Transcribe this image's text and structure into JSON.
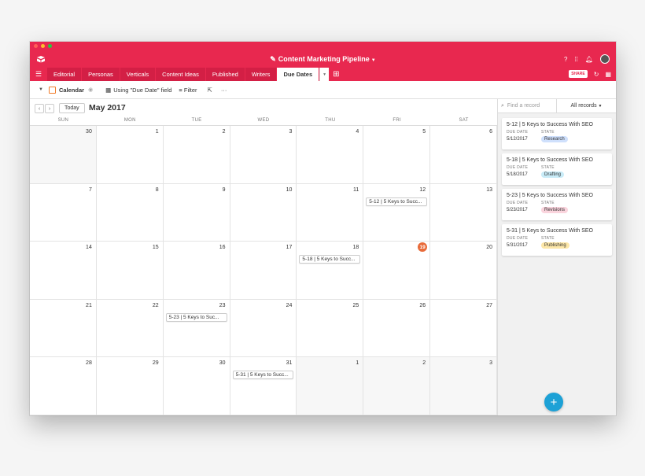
{
  "base": {
    "title": "Content Marketing Pipeline"
  },
  "tabs": [
    {
      "label": "Editorial"
    },
    {
      "label": "Personas"
    },
    {
      "label": "Verticals"
    },
    {
      "label": "Content Ideas"
    },
    {
      "label": "Published"
    },
    {
      "label": "Writers"
    },
    {
      "label": "Due Dates",
      "active": true
    }
  ],
  "share_label": "SHARE",
  "view": {
    "name": "Calendar",
    "using_label": "Using \"Due Date\" field",
    "filter_label": "Filter"
  },
  "calendar": {
    "today_label": "Today",
    "month_label": "May 2017",
    "weekdays": [
      "SUN",
      "MON",
      "TUE",
      "WED",
      "THU",
      "FRI",
      "SAT"
    ],
    "days": [
      {
        "n": "30",
        "other": true
      },
      {
        "n": "1"
      },
      {
        "n": "2"
      },
      {
        "n": "3"
      },
      {
        "n": "4"
      },
      {
        "n": "5"
      },
      {
        "n": "6"
      },
      {
        "n": "7"
      },
      {
        "n": "8"
      },
      {
        "n": "9"
      },
      {
        "n": "10"
      },
      {
        "n": "11"
      },
      {
        "n": "12",
        "event": "5-12 | 5 Keys to Succ..."
      },
      {
        "n": "13"
      },
      {
        "n": "14"
      },
      {
        "n": "15"
      },
      {
        "n": "16"
      },
      {
        "n": "17"
      },
      {
        "n": "18",
        "event": "5-18 | 5 Keys to Succ..."
      },
      {
        "n": "19",
        "today": true
      },
      {
        "n": "20"
      },
      {
        "n": "21"
      },
      {
        "n": "22"
      },
      {
        "n": "23",
        "event": "5-23 | 5 Keys to Suc..."
      },
      {
        "n": "24"
      },
      {
        "n": "25"
      },
      {
        "n": "26"
      },
      {
        "n": "27"
      },
      {
        "n": "28"
      },
      {
        "n": "29"
      },
      {
        "n": "30"
      },
      {
        "n": "31",
        "event": "5-31 | 5 Keys to Succ..."
      },
      {
        "n": "1",
        "other": true
      },
      {
        "n": "2",
        "other": true
      },
      {
        "n": "3",
        "other": true
      }
    ]
  },
  "sidebar": {
    "search_placeholder": "Find a record",
    "filter_label": "All records",
    "labels": {
      "due": "DUE DATE",
      "state": "STATE"
    },
    "records": [
      {
        "title": "5-12 | 5 Keys to Success With SEO",
        "due": "5/12/2017",
        "state": "Research",
        "color": "#cfe0fc"
      },
      {
        "title": "5-18 | 5 Keys to Success With SEO",
        "due": "5/18/2017",
        "state": "Drafting",
        "color": "#c9ecf8"
      },
      {
        "title": "5-23 | 5 Keys to Success With SEO",
        "due": "5/23/2017",
        "state": "Revisions",
        "color": "#fad4dd"
      },
      {
        "title": "5-31 | 5 Keys to Success With SEO",
        "due": "5/31/2017",
        "state": "Publishing",
        "color": "#fde7a8"
      }
    ]
  }
}
